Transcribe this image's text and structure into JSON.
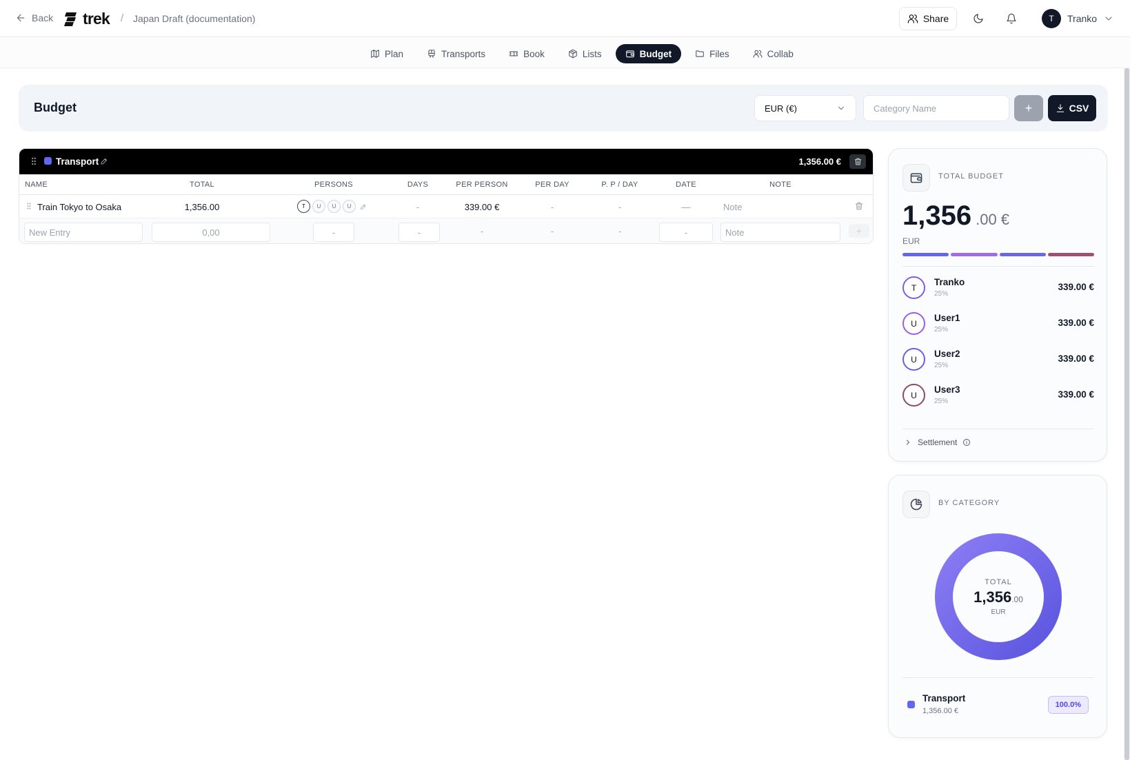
{
  "header": {
    "back_label": "Back",
    "logo_text": "trek",
    "breadcrumb_sep": "/",
    "trip_title": "Japan Draft (documentation)",
    "share_label": "Share",
    "user_initial": "T",
    "user_name": "Tranko"
  },
  "tabs": [
    {
      "label": "Plan",
      "icon": "map-icon"
    },
    {
      "label": "Transports",
      "icon": "train-icon"
    },
    {
      "label": "Book",
      "icon": "ticket-icon"
    },
    {
      "label": "Lists",
      "icon": "package-icon"
    },
    {
      "label": "Budget",
      "icon": "wallet-icon",
      "active": true
    },
    {
      "label": "Files",
      "icon": "folder-icon"
    },
    {
      "label": "Collab",
      "icon": "users-icon"
    }
  ],
  "budget": {
    "title": "Budget",
    "currency_selected": "EUR (€)",
    "category_placeholder": "Category Name",
    "add_label": "+",
    "csv_label": "CSV"
  },
  "category": {
    "name": "Transport",
    "color": "#6366f1",
    "total": "1,356.00 €",
    "columns": [
      "NAME",
      "TOTAL",
      "PERSONS",
      "DAYS",
      "PER PERSON",
      "PER DAY",
      "P. P / DAY",
      "DATE",
      "NOTE"
    ],
    "entry": {
      "name": "Train Tokyo to Osaka",
      "total": "1,356.00",
      "persons": [
        "T",
        "U",
        "U",
        "U"
      ],
      "days": "-",
      "per_person": "339.00 €",
      "per_day": "-",
      "pp_day": "-",
      "date": "—",
      "note": "Note"
    },
    "new_entry": {
      "name_placeholder": "New Entry",
      "total_placeholder": "0,00",
      "persons_placeholder": "-",
      "days_placeholder": "-",
      "per_person": "-",
      "per_day": "-",
      "pp_day": "-",
      "date_placeholder": "-",
      "note_placeholder": "Note",
      "add_label": "+"
    }
  },
  "total_budget": {
    "label": "TOTAL BUDGET",
    "amount_int": "1,356",
    "amount_dec": ".00 €",
    "currency": "EUR",
    "segment_colors": [
      "#6366f1",
      "#9f6bea",
      "#6e64e6",
      "#a0506a"
    ],
    "persons": [
      {
        "initial": "T",
        "name": "Tranko",
        "pct": "25%",
        "amount": "339.00 €",
        "color": "#7c5ce8"
      },
      {
        "initial": "U",
        "name": "User1",
        "pct": "25%",
        "amount": "339.00 €",
        "color": "#9b5de5"
      },
      {
        "initial": "U",
        "name": "User2",
        "pct": "25%",
        "amount": "339.00 €",
        "color": "#6a5ee6"
      },
      {
        "initial": "U",
        "name": "User3",
        "pct": "25%",
        "amount": "339.00 €",
        "color": "#8e4a5e"
      }
    ],
    "settlement_label": "Settlement"
  },
  "by_category": {
    "label": "BY CATEGORY",
    "donut_total_label": "TOTAL",
    "donut_int": "1,356",
    "donut_dec": ".00",
    "donut_currency": "EUR",
    "items": [
      {
        "name": "Transport",
        "amount": "1,356.00 €",
        "pct": "100.0%",
        "value": 100,
        "color": "#6366f1"
      }
    ]
  }
}
